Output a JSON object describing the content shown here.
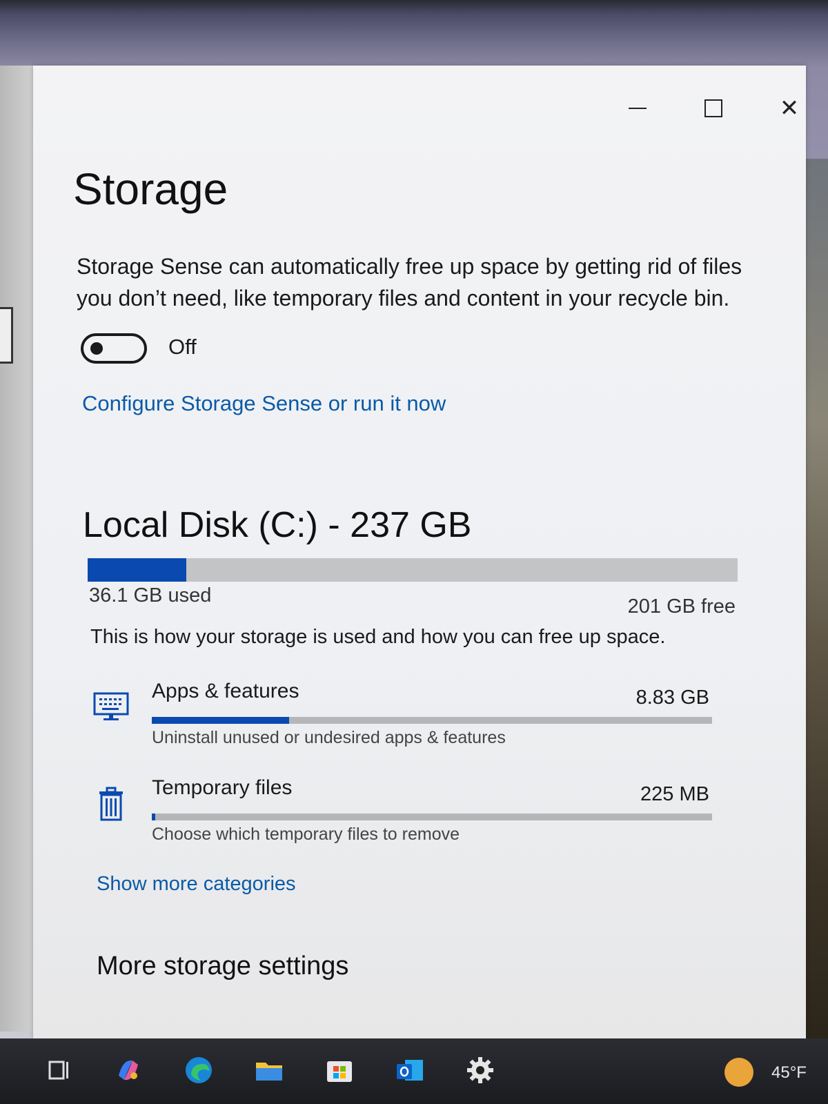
{
  "window": {
    "title": "Storage",
    "controls": {
      "minimize": "minimize-icon",
      "maximize": "maximize-icon",
      "close": "close-icon"
    }
  },
  "storage_sense": {
    "description": "Storage Sense can automatically free up space by getting rid of files you don’t need, like temporary files and content in your recycle bin.",
    "toggle_state": "Off",
    "toggle_on": false,
    "configure_link": "Configure Storage Sense or run it now"
  },
  "disk": {
    "title": "Local Disk (C:) - 237 GB",
    "used_label": "36.1 GB used",
    "free_label": "201 GB free",
    "used_fraction": 0.152
  },
  "usage_note": "This is how your storage is used and how you can free up space.",
  "categories": [
    {
      "name": "Apps & features",
      "size": "8.83 GB",
      "subtitle": "Uninstall unused or undesired apps & features",
      "fraction": 0.245,
      "icon": "monitor-keyboard-icon"
    },
    {
      "name": "Temporary files",
      "size": "225 MB",
      "subtitle": "Choose which temporary files to remove",
      "fraction": 0.006,
      "icon": "trash-icon"
    }
  ],
  "show_more": "Show more categories",
  "more_settings": "More storage settings",
  "taskbar": {
    "items": [
      "task-view-icon",
      "copilot-icon",
      "edge-icon",
      "file-explorer-icon",
      "store-icon",
      "outlook-icon",
      "settings-icon"
    ],
    "temperature": "45°F",
    "weather_icon": "sun-icon"
  },
  "colors": {
    "accent": "#0a4ab0",
    "link": "#0a5aa8",
    "bar_track": "#c3c4c6"
  }
}
